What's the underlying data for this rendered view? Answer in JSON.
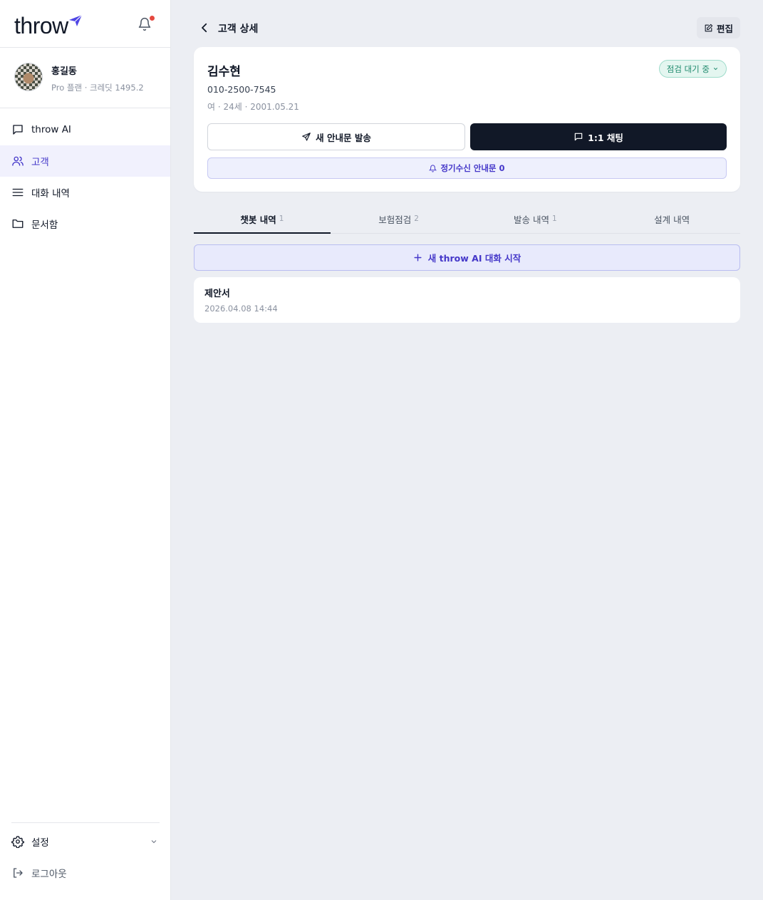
{
  "app": {
    "logo_text": "throw",
    "accent_color": "#4437c9",
    "notification_dot_color": "#e5483f"
  },
  "user": {
    "name": "홍길동",
    "plan_info": "Pro 플랜 · 크레딧 1495.2"
  },
  "nav": {
    "items": [
      {
        "label": "throw AI",
        "icon": "chat-bubble-icon"
      },
      {
        "label": "고객",
        "icon": "users-icon",
        "active": true
      },
      {
        "label": "대화 내역",
        "icon": "list-icon"
      },
      {
        "label": "문서함",
        "icon": "folder-icon"
      }
    ],
    "settings_label": "설정",
    "logout_label": "로그아웃"
  },
  "header": {
    "title": "고객 상세",
    "edit_label": "편집"
  },
  "customer": {
    "name": "김수현",
    "phone": "010-2500-7545",
    "meta": "여 · 24세 · 2001.05.21",
    "status": "점검 대기 중",
    "status_color": "#1f8a6d"
  },
  "actions": {
    "send_label": "새 안내문 발송",
    "chat_label": "1:1 채팅",
    "regular_label": "정기수신 안내문 0"
  },
  "tabs": [
    {
      "label": "챗봇 내역",
      "count": "1",
      "active": true
    },
    {
      "label": "보험점검",
      "count": "2"
    },
    {
      "label": "발송 내역",
      "count": "1"
    },
    {
      "label": "설계 내역",
      "count": ""
    }
  ],
  "new_chat_label": "새 throw AI 대화 시작",
  "history": [
    {
      "title": "제안서",
      "date": "2026.04.08 14:44"
    }
  ]
}
